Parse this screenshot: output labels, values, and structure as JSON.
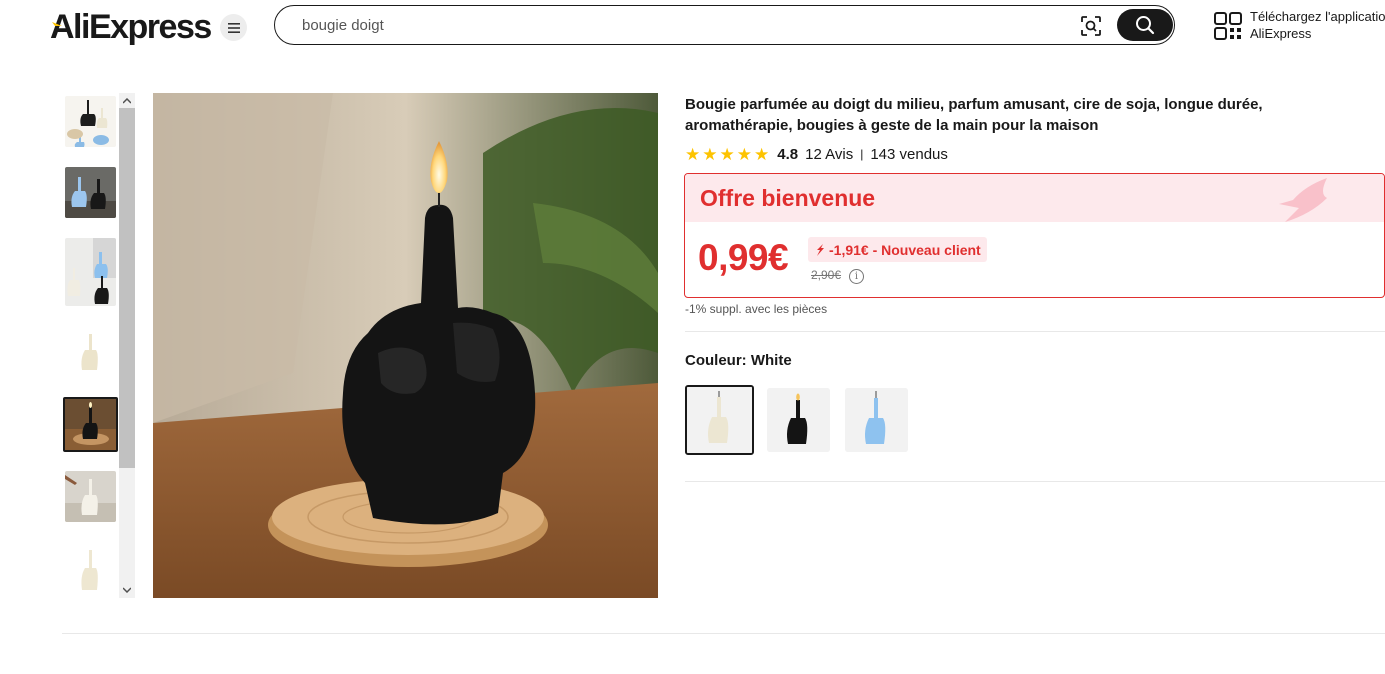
{
  "header": {
    "logo_text": "AliExpress",
    "search_value": "bougie doigt",
    "app_download_line1": "Téléchargez l'application",
    "app_download_line2": "AliExpress"
  },
  "product": {
    "title": "Bougie parfumée au doigt du milieu, parfum amusant, cire de soja, longue durée, aromathérapie, bougies à geste de la main pour la maison",
    "rating": "4.8",
    "rating_fraction": 0.96,
    "reviews": "12 Avis",
    "sold": "143 vendus",
    "offer_title": "Offre bienvenue",
    "price": "0,99€",
    "discount": "-1,91€ - Nouveau client",
    "old_price": "2,90€",
    "coins_note": "-1% suppl. avec les pièces",
    "color_label": "Couleur: White",
    "colors": [
      "White",
      "Black",
      "Blue"
    ],
    "selected_color": "White"
  },
  "gallery": {
    "thumbnail_count": 7,
    "active_thumbnail": 5
  },
  "colors": {
    "accent_red": "#e02f2f",
    "offer_bg": "#fde9ec",
    "star": "#fdc300",
    "text": "#191919"
  }
}
